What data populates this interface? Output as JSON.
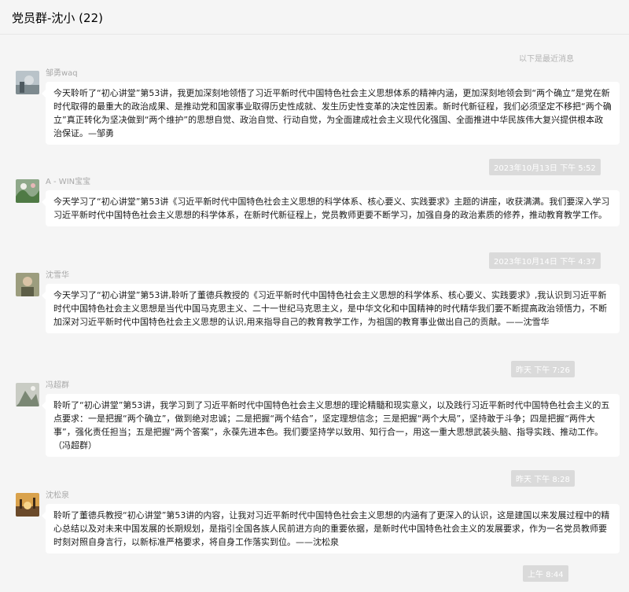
{
  "header": {
    "title": "党员群-沈小 (22)"
  },
  "system_notice": "以下是最近消息",
  "messages": [
    {
      "sender": "邹勇waq",
      "text": "今天聆听了“初心讲堂”第53讲，我更加深刻地领悟了习近平新时代中国特色社会主义思想体系的精神内涵，更加深刻地领会到“两个确立”是党在新时代取得的最重大的政治成果、是推动党和国家事业取得历史性成就、发生历史性变革的决定性因素。新时代新征程，我们必须坚定不移把“两个确立”真正转化为坚决做到“两个维护”的思想自觉、政治自觉、行动自觉，为全面建成社会主义现代化强国、全面推进中华民族伟大复兴提供根本政治保证。—邹勇"
    },
    {
      "timestamp": "2023年10月13日 下午 5:52",
      "sender": "A - WIN宝宝",
      "text": "今天学习了“初心讲堂”第53讲《习近平新时代中国特色社会主义思想的科学体系、核心要义、实践要求》主题的讲座，收获满满。我们要深入学习习近平新时代中国特色社会主义思想的科学体系，在新时代新征程上，党员教师更要不断学习，加强自身的政治素质的修养，推动教育教学工作。"
    },
    {
      "timestamp": "2023年10月14日 下午 4:37",
      "sender": "沈雪华",
      "text": "今天学习了“初心讲堂”第53讲,聆听了董德兵教授的《习近平新时代中国特色社会主义思想的科学体系、核心要义、实践要求》,我认识到习近平新时代中国特色社会主义思想是当代中国马克思主义、二十一世纪马克思主义，是中华文化和中国精神的时代精华我们要不断提高政治领悟力，不断加深对习近平新时代中国特色社会主义思想的认识,用来指导自己的教育教学工作，为祖国的教育事业做出自己的贡献。——沈雪华"
    },
    {
      "timestamp": "昨天 下午 7:26",
      "sender": "冯超群",
      "text": "聆听了“初心讲堂”第53讲，我学习到了习近平新时代中国特色社会主义思想的理论精髓和现实意义，以及践行习近平新时代中国特色社会主义的五点要求：一是把握“两个确立”，做到绝对忠诚；二是把握“两个结合”，坚定理想信念；三是把握“两个大局”，坚持敢于斗争；四是把握“两件大事”，强化责任担当；五是把握“两个答案”，永葆先进本色。我们要坚持学以致用、知行合一，用这一重大思想武装头脑、指导实践、推动工作。（冯超群）"
    },
    {
      "timestamp": "昨天 下午 8:28",
      "sender": "沈松泉",
      "text": "聆听了董德兵教授“初心讲堂”第53讲的内容，让我对习近平新时代中国特色社会主义思想的内涵有了更深入的认识，这是建国以来发展过程中的精心总结以及对未来中国发展的长期规划，是指引全国各族人民前进方向的重要依据，是新时代中国特色社会主义的发展要求，作为一名党员教师要时刻对照自身言行，以新标准严格要求，将自身工作落实到位。——沈松泉"
    }
  ],
  "last_timestamp": "上午 8:44",
  "colors": {
    "background": "#f5f5f5",
    "bubble": "#ffffff",
    "timestamp_bg": "#dadada",
    "sender_text": "#a8a8a8"
  }
}
